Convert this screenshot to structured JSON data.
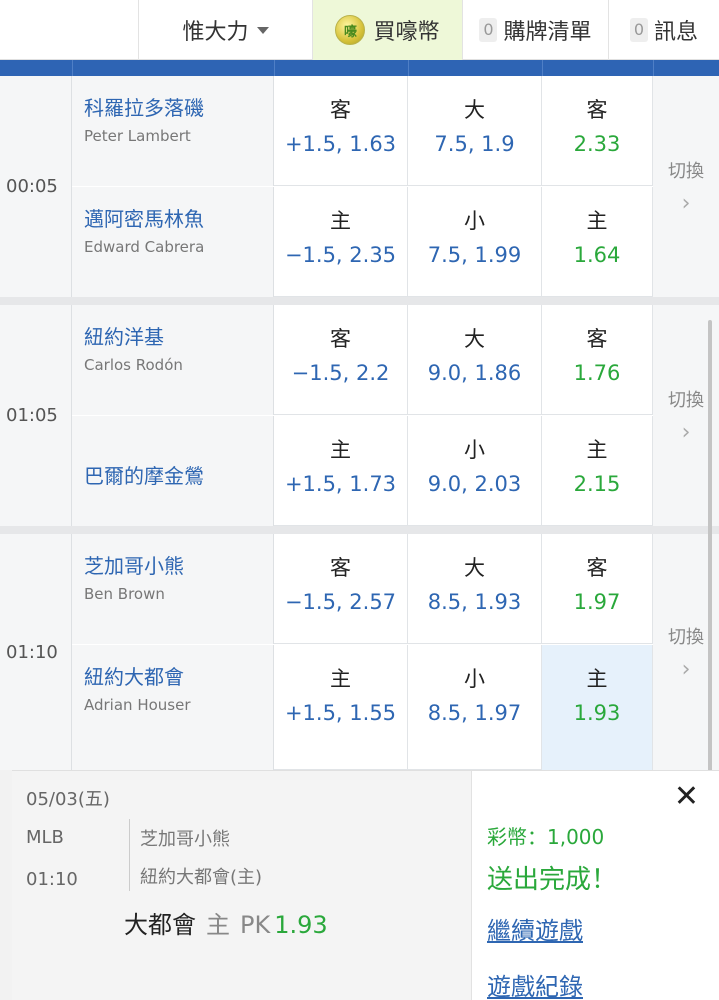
{
  "topbar": {
    "user_label": "惟大力",
    "buy_label": "買嚎幣",
    "coin_icon_text": "嚎",
    "cart_count": "0",
    "cart_label": "購牌清單",
    "msg_count": "0",
    "msg_label": "訊息"
  },
  "games": [
    {
      "time": "00:05",
      "switch_label": "切換",
      "rows": [
        {
          "team": "科羅拉多落磯",
          "pitcher": "Peter Lambert",
          "spread_label": "客",
          "spread": "+1.5, 1.63",
          "total_label": "大",
          "total": "7.5, 1.9",
          "ml_label": "客",
          "ml": "2.33"
        },
        {
          "team": "邁阿密馬林魚",
          "pitcher": "Edward Cabrera",
          "spread_label": "主",
          "spread": "−1.5, 2.35",
          "total_label": "小",
          "total": "7.5, 1.99",
          "ml_label": "主",
          "ml": "1.64"
        }
      ]
    },
    {
      "time": "01:05",
      "switch_label": "切換",
      "rows": [
        {
          "team": "紐約洋基",
          "pitcher": "Carlos Rodón",
          "spread_label": "客",
          "spread": "−1.5, 2.2",
          "total_label": "大",
          "total": "9.0, 1.86",
          "ml_label": "客",
          "ml": "1.76"
        },
        {
          "team": "巴爾的摩金鶯",
          "pitcher": "",
          "spread_label": "主",
          "spread": "+1.5, 1.73",
          "total_label": "小",
          "total": "9.0, 2.03",
          "ml_label": "主",
          "ml": "2.15"
        }
      ]
    },
    {
      "time": "01:10",
      "switch_label": "切換",
      "rows": [
        {
          "team": "芝加哥小熊",
          "pitcher": "Ben Brown",
          "spread_label": "客",
          "spread": "−1.5, 2.57",
          "total_label": "大",
          "total": "8.5, 1.93",
          "ml_label": "客",
          "ml": "1.97"
        },
        {
          "team": "紐約大都會",
          "pitcher": "Adrian Houser",
          "spread_label": "主",
          "spread": "+1.5, 1.55",
          "total_label": "小",
          "total": "8.5, 1.97",
          "ml_label": "主",
          "ml": "1.93"
        }
      ]
    }
  ],
  "slip": {
    "date": "05/03(五)",
    "league": "MLB",
    "time": "01:10",
    "away": "芝加哥小熊",
    "home": "紐約大都會(主)",
    "pick_team": "大都會",
    "pick_side": "主",
    "pick_type": "PK",
    "pick_odds": "1.93",
    "close_symbol": "✕",
    "coins_text": "彩幣：1,000",
    "done_text": "送出完成！",
    "continue_link": "繼續遊戲",
    "history_link": "遊戲紀錄"
  },
  "colors": {
    "header_blue": "#2e64b4",
    "team_blue": "#2e66b2",
    "odds_green": "#2aa83b",
    "selected_bg": "#e6f1fb"
  }
}
